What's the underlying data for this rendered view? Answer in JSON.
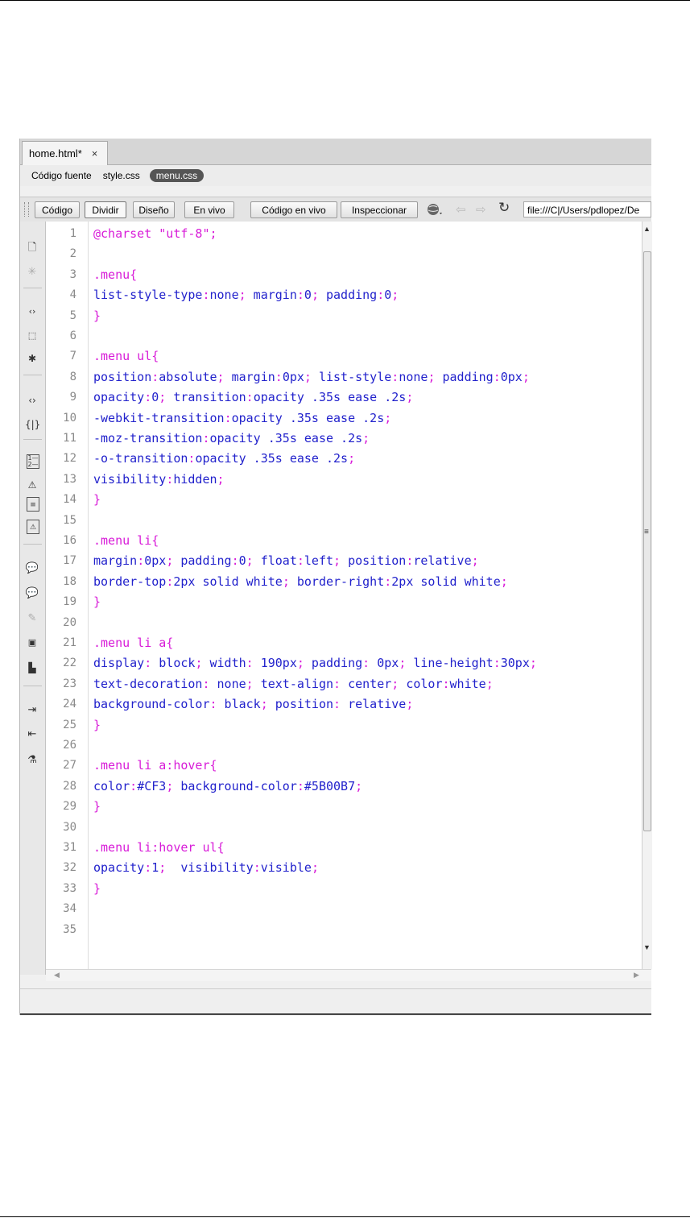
{
  "document_tab": {
    "title": "home.html*",
    "close": "×"
  },
  "related_files": [
    {
      "label": "Código fuente",
      "active": false
    },
    {
      "label": "style.css",
      "active": false
    },
    {
      "label": "menu.css",
      "active": true
    }
  ],
  "toolbar": {
    "codigo": "Código",
    "dividir": "Dividir",
    "diseno": "Diseño",
    "en_vivo": "En vivo",
    "codigo_en_vivo": "Código en vivo",
    "inspeccionar": "Inspeccionar",
    "address": "file:///C|/Users/pdlopez/De"
  },
  "side_tools": [
    "document-icon",
    "star-icon",
    "collapse-full-tag-icon",
    "collapse-selection-icon",
    "expand-all-icon",
    "select-parent-tag-icon",
    "balance-braces-icon",
    "line-numbers-icon",
    "highlight-invalid-code-icon",
    "word-wrap-icon",
    "syntax-coloring-icon",
    "apply-comment-icon",
    "remove-comment-icon",
    "wrap-tag-icon",
    "recent-snippets-icon",
    "move-css-icon",
    "indent-code-icon",
    "outdent-code-icon",
    "format-source-code-icon"
  ],
  "code_lines": [
    {
      "n": "1",
      "parts": [
        [
          "str",
          "@charset \"utf-8\";"
        ]
      ]
    },
    {
      "n": "2",
      "parts": []
    },
    {
      "n": "3",
      "parts": [
        [
          "sel",
          ".menu{"
        ]
      ]
    },
    {
      "n": "4",
      "parts": [
        [
          "prop",
          "list-style-type"
        ],
        [
          "punc",
          ":"
        ],
        [
          "val",
          "none"
        ],
        [
          "punc",
          ";"
        ],
        [
          "prop",
          " margin"
        ],
        [
          "punc",
          ":"
        ],
        [
          "val",
          "0"
        ],
        [
          "punc",
          ";"
        ],
        [
          "prop",
          " padding"
        ],
        [
          "punc",
          ":"
        ],
        [
          "val",
          "0"
        ],
        [
          "punc",
          ";"
        ]
      ]
    },
    {
      "n": "5",
      "parts": [
        [
          "sel",
          "}"
        ]
      ]
    },
    {
      "n": "6",
      "parts": []
    },
    {
      "n": "7",
      "parts": [
        [
          "sel",
          ".menu ul{"
        ]
      ]
    },
    {
      "n": "8",
      "parts": [
        [
          "prop",
          "position"
        ],
        [
          "punc",
          ":"
        ],
        [
          "val",
          "absolute"
        ],
        [
          "punc",
          ";"
        ],
        [
          "prop",
          " margin"
        ],
        [
          "punc",
          ":"
        ],
        [
          "val",
          "0px"
        ],
        [
          "punc",
          ";"
        ],
        [
          "prop",
          " list-style"
        ],
        [
          "punc",
          ":"
        ],
        [
          "val",
          "none"
        ],
        [
          "punc",
          ";"
        ],
        [
          "prop",
          " padding"
        ],
        [
          "punc",
          ":"
        ],
        [
          "val",
          "0px"
        ],
        [
          "punc",
          ";"
        ]
      ]
    },
    {
      "n": "9",
      "parts": [
        [
          "prop",
          "opacity"
        ],
        [
          "punc",
          ":"
        ],
        [
          "val",
          "0"
        ],
        [
          "punc",
          ";"
        ],
        [
          "prop",
          " transition"
        ],
        [
          "punc",
          ":"
        ],
        [
          "val",
          "opacity .35s ease .2s"
        ],
        [
          "punc",
          ";"
        ]
      ]
    },
    {
      "n": "10",
      "parts": [
        [
          "prop",
          "-webkit-transition"
        ],
        [
          "punc",
          ":"
        ],
        [
          "val",
          "opacity .35s ease .2s"
        ],
        [
          "punc",
          ";"
        ]
      ]
    },
    {
      "n": "11",
      "parts": [
        [
          "prop",
          "-moz-transition"
        ],
        [
          "punc",
          ":"
        ],
        [
          "val",
          "opacity .35s ease .2s"
        ],
        [
          "punc",
          ";"
        ]
      ]
    },
    {
      "n": "12",
      "parts": [
        [
          "prop",
          "-o-transition"
        ],
        [
          "punc",
          ":"
        ],
        [
          "val",
          "opacity .35s ease .2s"
        ],
        [
          "punc",
          ";"
        ]
      ]
    },
    {
      "n": "13",
      "parts": [
        [
          "prop",
          "visibility"
        ],
        [
          "punc",
          ":"
        ],
        [
          "val",
          "hidden"
        ],
        [
          "punc",
          ";"
        ]
      ]
    },
    {
      "n": "14",
      "parts": [
        [
          "sel",
          "}"
        ]
      ]
    },
    {
      "n": "15",
      "parts": []
    },
    {
      "n": "16",
      "parts": [
        [
          "sel",
          ".menu li{"
        ]
      ]
    },
    {
      "n": "17",
      "parts": [
        [
          "prop",
          "margin"
        ],
        [
          "punc",
          ":"
        ],
        [
          "val",
          "0px"
        ],
        [
          "punc",
          ";"
        ],
        [
          "prop",
          " padding"
        ],
        [
          "punc",
          ":"
        ],
        [
          "val",
          "0"
        ],
        [
          "punc",
          ";"
        ],
        [
          "prop",
          " float"
        ],
        [
          "punc",
          ":"
        ],
        [
          "val",
          "left"
        ],
        [
          "punc",
          ";"
        ],
        [
          "prop",
          " position"
        ],
        [
          "punc",
          ":"
        ],
        [
          "val",
          "relative"
        ],
        [
          "punc",
          ";"
        ]
      ]
    },
    {
      "n": "18",
      "parts": [
        [
          "prop",
          "border-top"
        ],
        [
          "punc",
          ":"
        ],
        [
          "val",
          "2px solid white"
        ],
        [
          "punc",
          ";"
        ],
        [
          "prop",
          " border-right"
        ],
        [
          "punc",
          ":"
        ],
        [
          "val",
          "2px solid white"
        ],
        [
          "punc",
          ";"
        ]
      ]
    },
    {
      "n": "19",
      "parts": [
        [
          "sel",
          "}"
        ]
      ]
    },
    {
      "n": "20",
      "parts": []
    },
    {
      "n": "21",
      "parts": [
        [
          "sel",
          ".menu li a{"
        ]
      ]
    },
    {
      "n": "22",
      "parts": [
        [
          "prop",
          "display"
        ],
        [
          "punc",
          ":"
        ],
        [
          "val",
          " block"
        ],
        [
          "punc",
          ";"
        ],
        [
          "prop",
          " width"
        ],
        [
          "punc",
          ":"
        ],
        [
          "val",
          " 190px"
        ],
        [
          "punc",
          ";"
        ],
        [
          "prop",
          " padding"
        ],
        [
          "punc",
          ":"
        ],
        [
          "val",
          " 0px"
        ],
        [
          "punc",
          ";"
        ],
        [
          "prop",
          " line-height"
        ],
        [
          "punc",
          ":"
        ],
        [
          "val",
          "30px"
        ],
        [
          "punc",
          ";"
        ]
      ]
    },
    {
      "n": "23",
      "parts": [
        [
          "prop",
          "text-decoration"
        ],
        [
          "punc",
          ":"
        ],
        [
          "val",
          " none"
        ],
        [
          "punc",
          ";"
        ],
        [
          "prop",
          " text-align"
        ],
        [
          "punc",
          ":"
        ],
        [
          "val",
          " center"
        ],
        [
          "punc",
          ";"
        ],
        [
          "prop",
          " color"
        ],
        [
          "punc",
          ":"
        ],
        [
          "val",
          "white"
        ],
        [
          "punc",
          ";"
        ]
      ]
    },
    {
      "n": "24",
      "parts": [
        [
          "prop",
          "background-color"
        ],
        [
          "punc",
          ":"
        ],
        [
          "val",
          " black"
        ],
        [
          "punc",
          ";"
        ],
        [
          "prop",
          " position"
        ],
        [
          "punc",
          ":"
        ],
        [
          "val",
          " relative"
        ],
        [
          "punc",
          ";"
        ]
      ]
    },
    {
      "n": "25",
      "parts": [
        [
          "sel",
          "}"
        ]
      ]
    },
    {
      "n": "26",
      "parts": []
    },
    {
      "n": "27",
      "parts": [
        [
          "sel",
          ".menu li a:hover{"
        ]
      ]
    },
    {
      "n": "28",
      "parts": [
        [
          "prop",
          "color"
        ],
        [
          "punc",
          ":"
        ],
        [
          "val",
          "#CF3"
        ],
        [
          "punc",
          ";"
        ],
        [
          "prop",
          " background-color"
        ],
        [
          "punc",
          ":"
        ],
        [
          "val",
          "#5B00B7"
        ],
        [
          "punc",
          ";"
        ]
      ]
    },
    {
      "n": "29",
      "parts": [
        [
          "sel",
          "}"
        ]
      ]
    },
    {
      "n": "30",
      "parts": []
    },
    {
      "n": "31",
      "parts": [
        [
          "sel",
          ".menu li:hover ul{"
        ]
      ]
    },
    {
      "n": "32",
      "parts": [
        [
          "prop",
          "opacity"
        ],
        [
          "punc",
          ":"
        ],
        [
          "val",
          "1"
        ],
        [
          "punc",
          ";"
        ],
        [
          "prop",
          "  visibility"
        ],
        [
          "punc",
          ":"
        ],
        [
          "val",
          "visible"
        ],
        [
          "punc",
          ";"
        ]
      ]
    },
    {
      "n": "33",
      "parts": [
        [
          "sel",
          "}"
        ]
      ]
    },
    {
      "n": "34",
      "parts": []
    },
    {
      "n": "35",
      "parts": []
    }
  ],
  "colors": {
    "selector": "#d81bd8",
    "property": "#2222cc",
    "line_number": "#8a8a8a"
  }
}
